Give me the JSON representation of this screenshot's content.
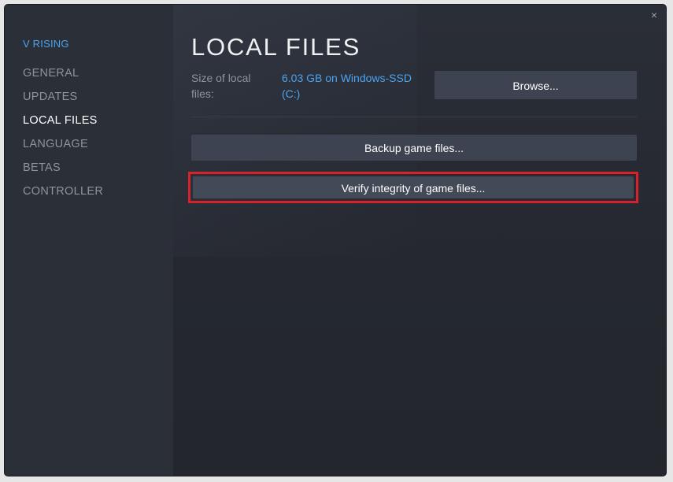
{
  "window": {
    "close_glyph": "×",
    "close_icon": "close-icon"
  },
  "sidebar": {
    "game_title": "V RISING",
    "items": [
      {
        "label": "GENERAL",
        "active": false
      },
      {
        "label": "UPDATES",
        "active": false
      },
      {
        "label": "LOCAL FILES",
        "active": true
      },
      {
        "label": "LANGUAGE",
        "active": false
      },
      {
        "label": "BETAS",
        "active": false
      },
      {
        "label": "CONTROLLER",
        "active": false
      }
    ]
  },
  "main": {
    "title": "LOCAL FILES",
    "size_label": "Size of local files:",
    "size_value": "6.03 GB on Windows-SSD (C:)",
    "browse_label": "Browse...",
    "backup_label": "Backup game files...",
    "verify_label": "Verify integrity of game files..."
  },
  "colors": {
    "accent_blue": "#4aa3f0",
    "highlight_red": "#d8212b",
    "button_bg": "#3d4350",
    "sidebar_bg": "#2b2f38",
    "main_bg": "#252830"
  }
}
